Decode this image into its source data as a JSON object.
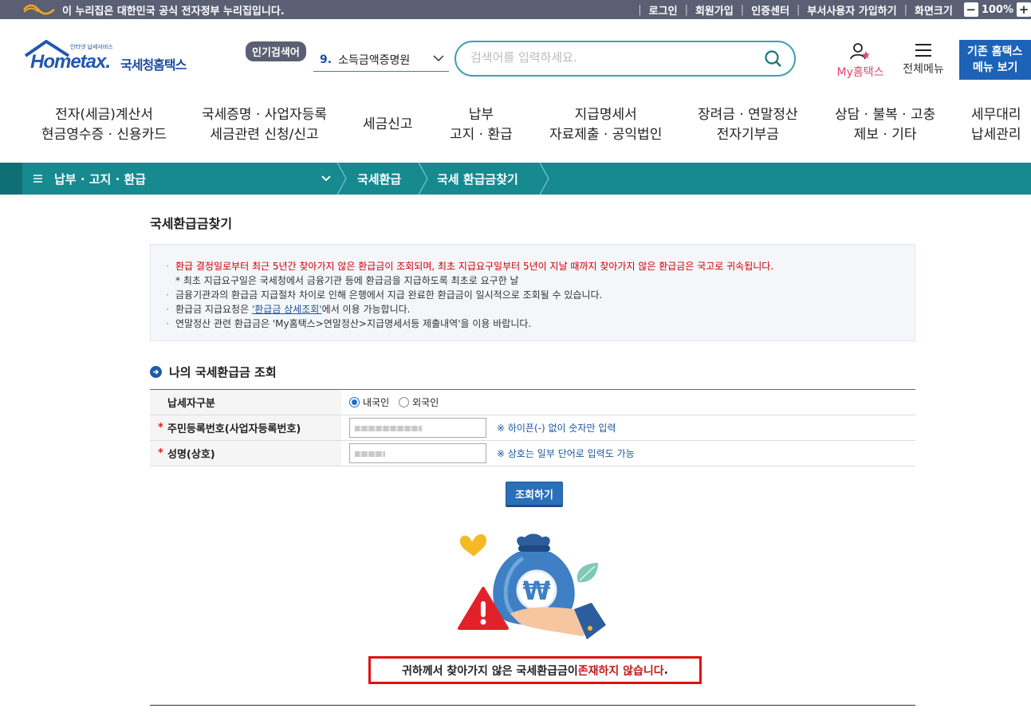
{
  "gov_banner": {
    "text": "이 누리집은 대한민국 공식 전자정부 누리집입니다.",
    "links": [
      "로그인",
      "회원가입",
      "인증센터",
      "부서사용자 가입하기",
      "화면크기"
    ],
    "zoom_minus": "−",
    "zoom_value": "100%",
    "zoom_plus": "+"
  },
  "header": {
    "logo_en": "Hometax.",
    "logo_ko": "국세청홈택스",
    "logo_small": "인터넷 납세서비스",
    "popular_badge": "인기검색어",
    "popular_num": "9.",
    "popular_term": "소득금액증명원",
    "search_placeholder": "검색어를 입력하세요.",
    "my_hometax": "My홈택스",
    "all_menu": "전체메뉴",
    "old_menu_line1": "기존 홈택스",
    "old_menu_line2": "메뉴 보기"
  },
  "gnb": [
    {
      "l1": "전자(세금)계산서",
      "l2": "현금영수증 · 신용카드"
    },
    {
      "l1": "국세증명 · 사업자등록",
      "l2": "세금관련 신청/신고"
    },
    {
      "l1": "세금신고",
      "l2": ""
    },
    {
      "l1": "납부",
      "l2": "고지 · 환급"
    },
    {
      "l1": "지급명세서",
      "l2": "자료제출 · 공익법인"
    },
    {
      "l1": "장려금 · 연말정산",
      "l2": "전자기부금"
    },
    {
      "l1": "상담 · 불복 · 고충",
      "l2": "제보 · 기타"
    },
    {
      "l1": "세무대리",
      "l2": "납세관리"
    }
  ],
  "breadcrumb": {
    "menu": "납부 · 고지 · 환급",
    "level2": "국세환급",
    "level3": "국세 환급금찾기"
  },
  "page": {
    "title": "국세환급금찾기",
    "notice": {
      "line1": "환급 결정일로부터 최근 5년간 찾아가지 않은 환급금이 조회되며, 최초 지급요구일부터 5년이 지날 때까지 찾아가지 않은 환급금은 국고로 귀속됩니다.",
      "line1_sub": "* 최초 지급요구일은 국세청에서 금융기관 등에 환급금을 지급하도록 최초로 요구한 날",
      "line2": "금융기관과의 환급금 지급절차 차이로 인해 은행에서 지급 완료한 환급금이 일시적으로 조회될 수 있습니다.",
      "line3_pre": "환급금 지급요청은 ",
      "line3_link": "'환급금 상세조회'",
      "line3_post": "에서 이용 가능합니다.",
      "line4": "연말정산 관련 환급금은 'My홈택스>연말정산>지급명세서등 제출내역'을 이용 바랍니다."
    },
    "section_title": "나의 국세환급금 조회",
    "form": {
      "row1_label": "납세자구분",
      "radio_domestic": "내국인",
      "radio_foreign": "외국인",
      "row2_label": "주민등록번호(사업자등록번호)",
      "row2_hint": "※ 하이픈(-) 없이 숫자만 입력",
      "row3_label": "성명(상호)",
      "row3_hint": "※ 상호는 일부 단어로 입력도 가능",
      "required_mark": "*"
    },
    "search_button": "조회하기",
    "result_pre": "귀하께서 찾아가지 않은 국세환급금이 ",
    "result_red": "존재하지 않습니다",
    "result_post": "."
  },
  "colors": {
    "gov_bar": "#5a5f73",
    "crumb_bar": "#168a8f",
    "brand_blue": "#1c63b7",
    "alert_red": "#e01010"
  }
}
